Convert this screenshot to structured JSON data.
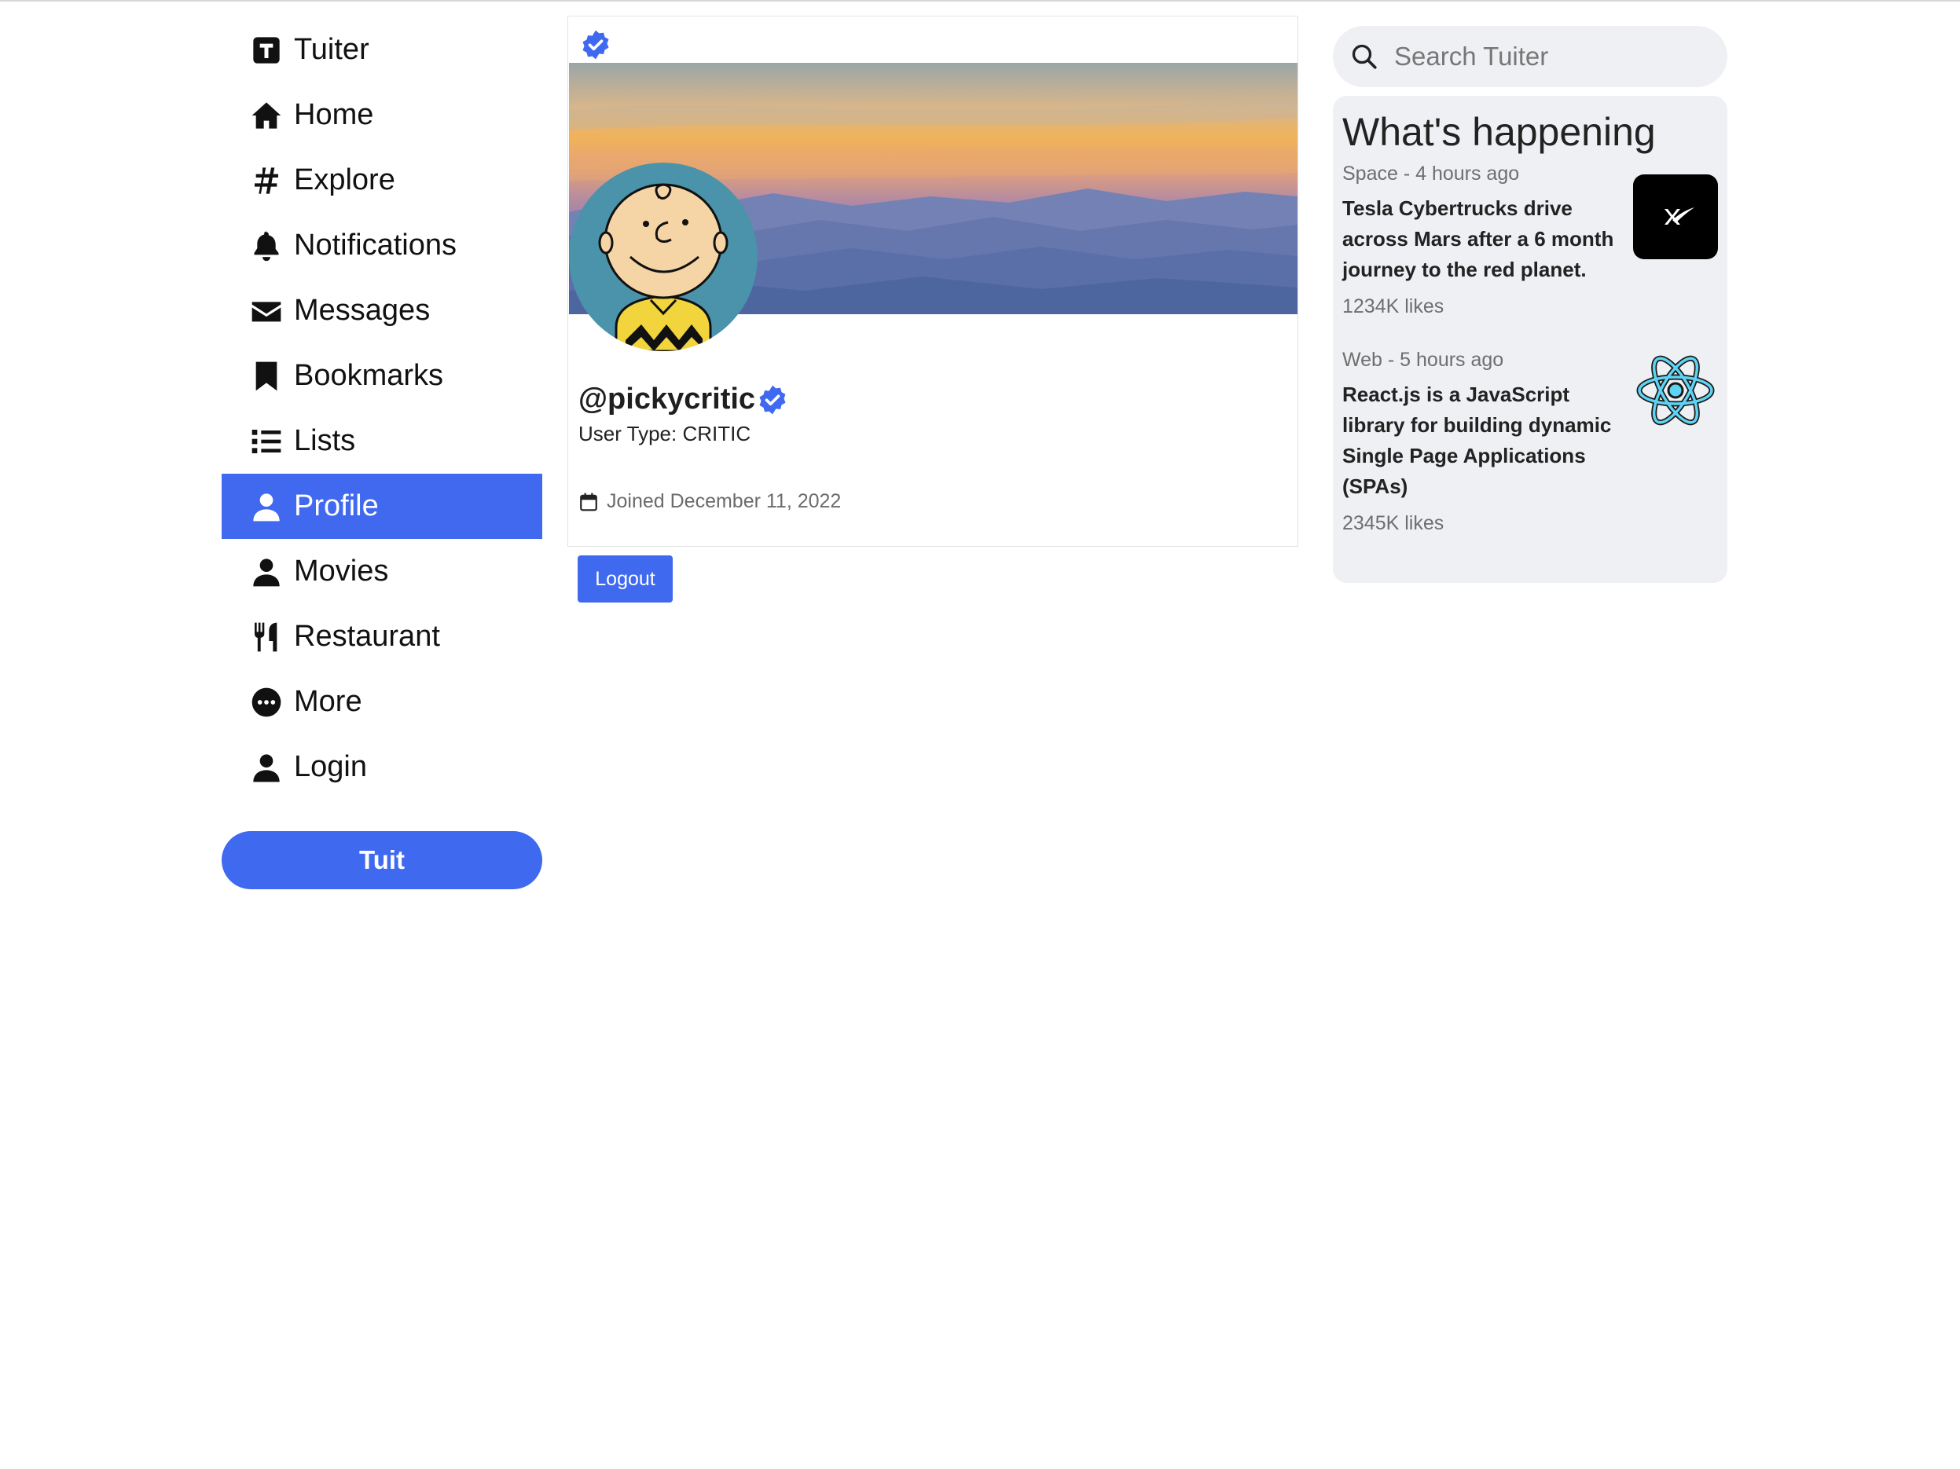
{
  "sidebar": {
    "items": [
      {
        "label": "Tuiter",
        "icon": "tuiter-logo-icon"
      },
      {
        "label": "Home",
        "icon": "home-icon"
      },
      {
        "label": "Explore",
        "icon": "hashtag-icon"
      },
      {
        "label": "Notifications",
        "icon": "bell-icon"
      },
      {
        "label": "Messages",
        "icon": "envelope-icon"
      },
      {
        "label": "Bookmarks",
        "icon": "bookmark-icon"
      },
      {
        "label": "Lists",
        "icon": "list-icon"
      },
      {
        "label": "Profile",
        "icon": "user-icon",
        "active": true
      },
      {
        "label": "Movies",
        "icon": "user-icon"
      },
      {
        "label": "Restaurant",
        "icon": "utensils-icon"
      },
      {
        "label": "More",
        "icon": "ellipsis-circle-icon"
      },
      {
        "label": "Login",
        "icon": "user-icon"
      }
    ],
    "tuit_label": "Tuit"
  },
  "profile": {
    "handle": "@pickycritic",
    "user_type": "User Type: CRITIC",
    "joined": "Joined December 11, 2022",
    "logout_label": "Logout"
  },
  "search": {
    "placeholder": "Search Tuiter"
  },
  "trends": {
    "title": "What's happening",
    "items": [
      {
        "meta": "Space - 4 hours ago",
        "headline": "Tesla Cybertrucks drive across Mars after a 6 month journey to the red planet.",
        "likes": "1234K likes",
        "thumb": "spacex-logo"
      },
      {
        "meta": "Web - 5 hours ago",
        "headline": "React.js is a JavaScript library for building dynamic Single Page Applications (SPAs)",
        "likes": "2345K likes",
        "thumb": "react-logo"
      }
    ]
  },
  "colors": {
    "accent": "#4169f0",
    "verified": "#3f6af0",
    "panel": "#eef0f3"
  }
}
